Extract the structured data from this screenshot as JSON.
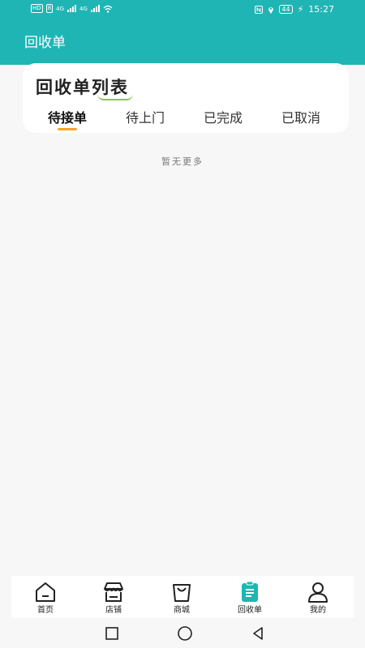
{
  "status_bar": {
    "left_chip": "HD",
    "left_chip2": "8",
    "net1": "4G",
    "net2": "4G",
    "battery": "44",
    "time": "15:27"
  },
  "header": {
    "title": "回收单"
  },
  "card": {
    "title": "回收单列表",
    "tabs": [
      {
        "label": "待接单",
        "active": true
      },
      {
        "label": "待上门",
        "active": false
      },
      {
        "label": "已完成",
        "active": false
      },
      {
        "label": "已取消",
        "active": false
      }
    ]
  },
  "empty_text": "暂无更多",
  "bottom_nav": {
    "items": [
      {
        "label": "首页",
        "icon": "home-icon"
      },
      {
        "label": "店铺",
        "icon": "store-icon"
      },
      {
        "label": "商城",
        "icon": "shopping-bag-icon"
      },
      {
        "label": "回收单",
        "icon": "clipboard-list-icon",
        "active": true
      },
      {
        "label": "我的",
        "icon": "user-icon"
      }
    ]
  },
  "colors": {
    "primary": "#1fb5b4",
    "tab_indicator": "#f5a623",
    "title_underline": "#8cc63f"
  }
}
